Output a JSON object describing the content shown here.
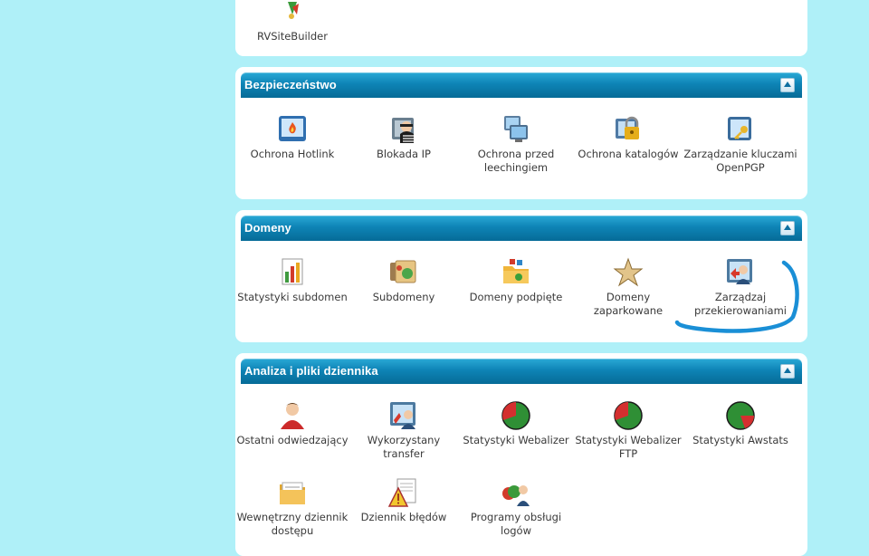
{
  "top_panel": {
    "item_label": "RVSiteBuilder"
  },
  "security": {
    "title": "Bezpieczeństwo",
    "items": [
      {
        "label": "Ochrona Hotlink",
        "icon": "hotlink-protection-icon"
      },
      {
        "label": "Blokada IP",
        "icon": "ip-blocker-icon"
      },
      {
        "label": "Ochrona przed leechingiem",
        "icon": "leech-protection-icon"
      },
      {
        "label": "Ochrona katalogów",
        "icon": "directory-lock-icon"
      },
      {
        "label": "Zarządzanie kluczami OpenPGP",
        "icon": "gpg-keys-icon"
      }
    ]
  },
  "domains": {
    "title": "Domeny",
    "items": [
      {
        "label": "Statystyki subdomen",
        "icon": "subdomain-stats-icon"
      },
      {
        "label": "Subdomeny",
        "icon": "subdomains-icon"
      },
      {
        "label": "Domeny podpięte",
        "icon": "addon-domains-icon"
      },
      {
        "label": "Domeny zaparkowane",
        "icon": "parked-domains-icon"
      },
      {
        "label": "Zarządzaj przekierowaniami",
        "icon": "redirects-icon"
      }
    ]
  },
  "logs": {
    "title": "Analiza i pliki dziennika",
    "items": [
      {
        "label": "Ostatni odwiedzający",
        "icon": "latest-visitors-icon"
      },
      {
        "label": "Wykorzystany transfer",
        "icon": "bandwidth-icon"
      },
      {
        "label": "Statystyki Webalizer",
        "icon": "webalizer-icon"
      },
      {
        "label": "Statystyki Webalizer FTP",
        "icon": "webalizer-ftp-icon"
      },
      {
        "label": "Statystyki Awstats",
        "icon": "awstats-icon"
      },
      {
        "label": "Wewnętrzny dziennik dostępu",
        "icon": "raw-access-logs-icon"
      },
      {
        "label": "Dziennik błędów",
        "icon": "error-log-icon"
      },
      {
        "label": "Programy obsługi logów",
        "icon": "log-programs-icon"
      }
    ]
  },
  "colors": {
    "page_background": "#aff0f8",
    "header_gradient_top": "#2aa9d6",
    "header_gradient_bottom": "#066b97",
    "annotation_stroke": "#1a8fd6"
  }
}
